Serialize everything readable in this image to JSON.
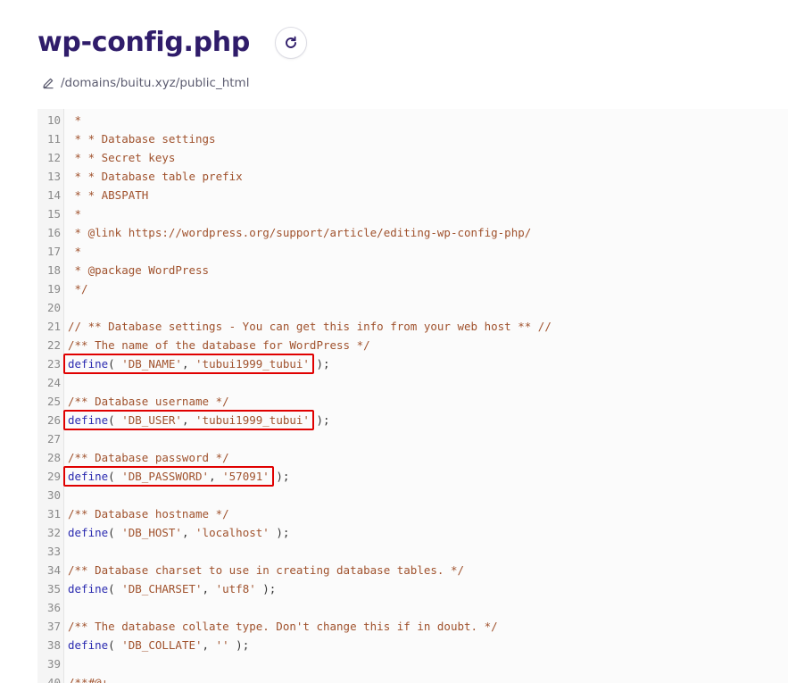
{
  "header": {
    "title": "wp-config.php",
    "refresh_icon": "refresh-icon"
  },
  "path": {
    "edit_icon": "pencil-icon",
    "text": "/domains/buitu.xyz/public_html"
  },
  "editor": {
    "lines": [
      {
        "n": "10",
        "t": [
          [
            "cm",
            " *"
          ]
        ]
      },
      {
        "n": "11",
        "t": [
          [
            "cm",
            " * * Database settings"
          ]
        ]
      },
      {
        "n": "12",
        "t": [
          [
            "cm",
            " * * Secret keys"
          ]
        ]
      },
      {
        "n": "13",
        "t": [
          [
            "cm",
            " * * Database table prefix"
          ]
        ]
      },
      {
        "n": "14",
        "t": [
          [
            "cm",
            " * * ABSPATH"
          ]
        ]
      },
      {
        "n": "15",
        "t": [
          [
            "cm",
            " *"
          ]
        ]
      },
      {
        "n": "16",
        "t": [
          [
            "cm",
            " * @link https://wordpress.org/support/article/editing-wp-config-php/"
          ]
        ]
      },
      {
        "n": "17",
        "t": [
          [
            "cm",
            " *"
          ]
        ]
      },
      {
        "n": "18",
        "t": [
          [
            "cm",
            " * @package WordPress"
          ]
        ]
      },
      {
        "n": "19",
        "t": [
          [
            "cm",
            " */"
          ]
        ]
      },
      {
        "n": "20",
        "t": []
      },
      {
        "n": "21",
        "t": [
          [
            "cm",
            "// ** Database settings - You can get this info from your web host ** //"
          ]
        ]
      },
      {
        "n": "22",
        "t": [
          [
            "cm",
            "/** The name of the database for WordPress */"
          ]
        ]
      },
      {
        "n": "23",
        "t": [
          [
            "kw",
            "define"
          ],
          [
            "pl",
            "( "
          ],
          [
            "st",
            "'DB_NAME'"
          ],
          [
            "pl",
            ", "
          ],
          [
            "st",
            "'tubui1999_tubui'"
          ],
          [
            "pl",
            " );"
          ]
        ]
      },
      {
        "n": "24",
        "t": []
      },
      {
        "n": "25",
        "t": [
          [
            "cm",
            "/** Database username */"
          ]
        ]
      },
      {
        "n": "26",
        "t": [
          [
            "kw",
            "define"
          ],
          [
            "pl",
            "( "
          ],
          [
            "st",
            "'DB_USER'"
          ],
          [
            "pl",
            ", "
          ],
          [
            "st",
            "'tubui1999_tubui'"
          ],
          [
            "pl",
            " );"
          ]
        ]
      },
      {
        "n": "27",
        "t": []
      },
      {
        "n": "28",
        "t": [
          [
            "cm",
            "/** Database password */"
          ]
        ]
      },
      {
        "n": "29",
        "t": [
          [
            "kw",
            "define"
          ],
          [
            "pl",
            "( "
          ],
          [
            "st",
            "'DB_PASSWORD'"
          ],
          [
            "pl",
            ", "
          ],
          [
            "st",
            "'57091'"
          ],
          [
            "pl",
            " );"
          ]
        ]
      },
      {
        "n": "30",
        "t": []
      },
      {
        "n": "31",
        "t": [
          [
            "cm",
            "/** Database hostname */"
          ]
        ]
      },
      {
        "n": "32",
        "t": [
          [
            "kw",
            "define"
          ],
          [
            "pl",
            "( "
          ],
          [
            "st",
            "'DB_HOST'"
          ],
          [
            "pl",
            ", "
          ],
          [
            "st",
            "'localhost'"
          ],
          [
            "pl",
            " );"
          ]
        ]
      },
      {
        "n": "33",
        "t": []
      },
      {
        "n": "34",
        "t": [
          [
            "cm",
            "/** Database charset to use in creating database tables. */"
          ]
        ]
      },
      {
        "n": "35",
        "t": [
          [
            "kw",
            "define"
          ],
          [
            "pl",
            "( "
          ],
          [
            "st",
            "'DB_CHARSET'"
          ],
          [
            "pl",
            ", "
          ],
          [
            "st",
            "'utf8'"
          ],
          [
            "pl",
            " );"
          ]
        ]
      },
      {
        "n": "36",
        "t": []
      },
      {
        "n": "37",
        "t": [
          [
            "cm",
            "/** The database collate type. Don't change this if in doubt. */"
          ]
        ]
      },
      {
        "n": "38",
        "t": [
          [
            "kw",
            "define"
          ],
          [
            "pl",
            "( "
          ],
          [
            "st",
            "'DB_COLLATE'"
          ],
          [
            "pl",
            ", "
          ],
          [
            "st",
            "''"
          ],
          [
            "pl",
            " );"
          ]
        ]
      },
      {
        "n": "39",
        "t": []
      },
      {
        "n": "40",
        "t": [
          [
            "cm",
            "/**#@+"
          ]
        ]
      }
    ],
    "highlights": [
      {
        "line": "23",
        "covers": "define( 'DB_NAME', 'tubui1999_tubui'"
      },
      {
        "line": "26",
        "covers": "define( 'DB_USER', 'tubui1999_tubui'"
      },
      {
        "line": "29",
        "covers": "define( 'DB_PASSWORD', '57091'"
      }
    ],
    "highlight_color": "#e00000"
  }
}
